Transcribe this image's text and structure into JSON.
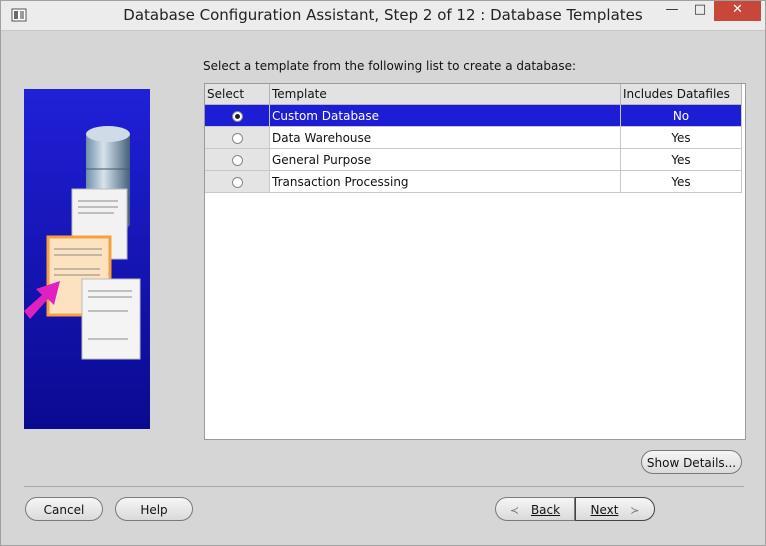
{
  "window": {
    "title": "Database Configuration Assistant, Step 2 of 12 : Database Templates",
    "controls": {
      "minimize": "—",
      "maximize": "□",
      "close": "✕"
    }
  },
  "instruction": "Select a template from the following list to create a database:",
  "table": {
    "headers": {
      "select": "Select",
      "template": "Template",
      "includes": "Includes Datafiles"
    },
    "rows": [
      {
        "template": "Custom Database",
        "includes": "No",
        "selected": true
      },
      {
        "template": "Data Warehouse",
        "includes": "Yes",
        "selected": false
      },
      {
        "template": "General Purpose",
        "includes": "Yes",
        "selected": false
      },
      {
        "template": "Transaction Processing",
        "includes": "Yes",
        "selected": false
      }
    ]
  },
  "buttons": {
    "show_details": "Show Details...",
    "cancel": "Cancel",
    "help": "Help",
    "back": "Back",
    "next": "Next",
    "back_arrow": "≺",
    "next_arrow": "≻"
  },
  "colors": {
    "selection": "#1d1dd6",
    "panel_background": "#d6d6d6",
    "illustration_blue": "#1515c8"
  }
}
